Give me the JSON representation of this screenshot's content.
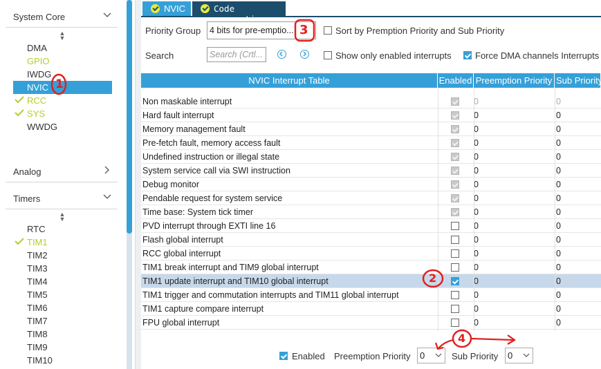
{
  "left": {
    "system_core": {
      "label": "System Core",
      "items": [
        {
          "label": "DMA",
          "state": "plain"
        },
        {
          "label": "GPIO",
          "state": "configured"
        },
        {
          "label": "IWDG",
          "state": "plain"
        },
        {
          "label": "NVIC",
          "state": "selected"
        },
        {
          "label": "RCC",
          "state": "checked"
        },
        {
          "label": "SYS",
          "state": "checked"
        },
        {
          "label": "WWDG",
          "state": "plain"
        }
      ]
    },
    "analog": {
      "label": "Analog"
    },
    "timers": {
      "label": "Timers",
      "items": [
        {
          "label": "RTC",
          "state": "plain"
        },
        {
          "label": "TIM1",
          "state": "checked"
        },
        {
          "label": "TIM2",
          "state": "plain"
        },
        {
          "label": "TIM3",
          "state": "plain"
        },
        {
          "label": "TIM4",
          "state": "plain"
        },
        {
          "label": "TIM5",
          "state": "plain"
        },
        {
          "label": "TIM6",
          "state": "plain"
        },
        {
          "label": "TIM7",
          "state": "plain"
        },
        {
          "label": "TIM8",
          "state": "plain"
        },
        {
          "label": "TIM9",
          "state": "plain"
        },
        {
          "label": "TIM10",
          "state": "plain"
        }
      ]
    }
  },
  "tabs": [
    {
      "label": "NVIC",
      "active": true
    },
    {
      "label": "Code generation",
      "active": false
    }
  ],
  "config": {
    "priority_group_label": "Priority Group",
    "priority_group_value": "4 bits for pre-emptio...",
    "sort_label": "Sort by Premption Priority and Sub Priority",
    "sort_checked": false,
    "search_label": "Search",
    "search_placeholder": "Search (Crtl...",
    "show_enabled_label": "Show only enabled interrupts",
    "show_enabled_checked": false,
    "force_dma_label": "Force DMA channels Interrupts",
    "force_dma_checked": true
  },
  "table": {
    "headers": [
      "NVIC Interrupt Table",
      "Enabled",
      "Preemption Priority",
      "Sub Priority"
    ],
    "rows": [
      {
        "name": "Non maskable interrupt",
        "enabled": "locked",
        "pre": "0",
        "sub": "0",
        "grey": true
      },
      {
        "name": "Hard fault interrupt",
        "enabled": "locked",
        "pre": "0",
        "sub": "0",
        "grey": false
      },
      {
        "name": "Memory management fault",
        "enabled": "locked",
        "pre": "0",
        "sub": "0",
        "grey": false
      },
      {
        "name": "Pre-fetch fault, memory access fault",
        "enabled": "locked",
        "pre": "0",
        "sub": "0",
        "grey": false
      },
      {
        "name": "Undefined instruction or illegal state",
        "enabled": "locked",
        "pre": "0",
        "sub": "0",
        "grey": false
      },
      {
        "name": "System service call via SWI instruction",
        "enabled": "locked",
        "pre": "0",
        "sub": "0",
        "grey": false
      },
      {
        "name": "Debug monitor",
        "enabled": "locked",
        "pre": "0",
        "sub": "0",
        "grey": false
      },
      {
        "name": "Pendable request for system service",
        "enabled": "locked",
        "pre": "0",
        "sub": "0",
        "grey": false
      },
      {
        "name": "Time base: System tick timer",
        "enabled": "locked",
        "pre": "0",
        "sub": "0",
        "grey": false
      },
      {
        "name": "PVD interrupt through EXTI line 16",
        "enabled": "off",
        "pre": "0",
        "sub": "0",
        "grey": false
      },
      {
        "name": "Flash global interrupt",
        "enabled": "off",
        "pre": "0",
        "sub": "0",
        "grey": false
      },
      {
        "name": "RCC global interrupt",
        "enabled": "off",
        "pre": "0",
        "sub": "0",
        "grey": false
      },
      {
        "name": "TIM1 break interrupt and TIM9 global interrupt",
        "enabled": "off",
        "pre": "0",
        "sub": "0",
        "grey": false
      },
      {
        "name": "TIM1 update interrupt and TIM10 global interrupt",
        "enabled": "on",
        "pre": "0",
        "sub": "0",
        "grey": false,
        "selected": true
      },
      {
        "name": "TIM1 trigger and commutation interrupts and TIM11 global interrupt",
        "enabled": "off",
        "pre": "0",
        "sub": "0",
        "grey": false
      },
      {
        "name": "TIM1 capture compare interrupt",
        "enabled": "off",
        "pre": "0",
        "sub": "0",
        "grey": false
      },
      {
        "name": "FPU global interrupt",
        "enabled": "off",
        "pre": "0",
        "sub": "0",
        "grey": false
      }
    ]
  },
  "bottom": {
    "enabled_label": "Enabled",
    "enabled_checked": true,
    "preemption_label": "Preemption Priority",
    "preemption_value": "0",
    "sub_label": "Sub Priority",
    "sub_value": "0"
  },
  "annotations": [
    "1",
    "2",
    "3",
    "4"
  ],
  "colors": {
    "accent": "#35a0d8",
    "tab_bg": "#1c4d6d",
    "configured": "#b8cc2a",
    "annotation": "#e02020"
  }
}
